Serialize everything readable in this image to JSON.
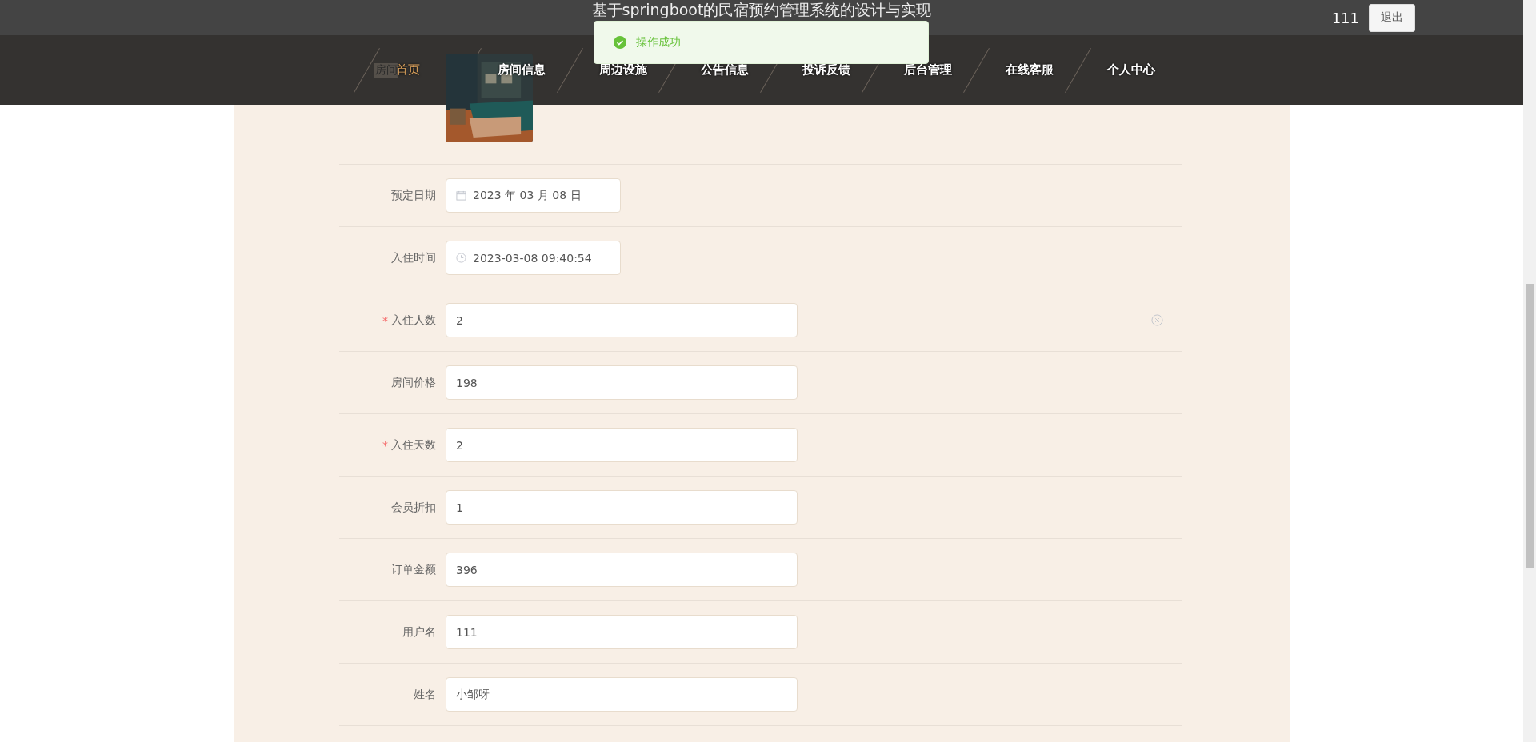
{
  "header": {
    "title": "基于springboot的民宿预约管理系统的设计与实现",
    "username": "111",
    "logout": "退出"
  },
  "toast": {
    "kind": "success",
    "message": "操作成功"
  },
  "nav": [
    {
      "label": "首页",
      "selected": true
    },
    {
      "label": "房间信息",
      "selected": false
    },
    {
      "label": "周边设施",
      "selected": false
    },
    {
      "label": "公告信息",
      "selected": false
    },
    {
      "label": "投诉反馈",
      "selected": false
    },
    {
      "label": "后台管理",
      "selected": false
    },
    {
      "label": "在线客服",
      "selected": false
    },
    {
      "label": "个人中心",
      "selected": false
    }
  ],
  "form": {
    "required_mark": "*",
    "picture_row": {
      "label": "房间",
      "kind": "picture"
    },
    "fields": [
      {
        "label": "预定日期",
        "kind": "date",
        "value": "2023 年 03 月 08 日",
        "required": false,
        "clearable": false
      },
      {
        "label": "入住时间",
        "kind": "time",
        "value": "2023-03-08 09:40:54",
        "required": false,
        "clearable": false
      },
      {
        "label": "入住人数",
        "kind": "text",
        "value": "2",
        "required": true,
        "clearable": true
      },
      {
        "label": "房间价格",
        "kind": "text",
        "value": "198",
        "required": false,
        "clearable": false
      },
      {
        "label": "入住天数",
        "kind": "text",
        "value": "2",
        "required": true,
        "clearable": false
      },
      {
        "label": "会员折扣",
        "kind": "text",
        "value": "1",
        "required": false,
        "clearable": false
      },
      {
        "label": "订单金额",
        "kind": "text",
        "value": "396",
        "required": false,
        "clearable": false
      },
      {
        "label": "用户名",
        "kind": "text",
        "value": "111",
        "required": false,
        "clearable": false
      },
      {
        "label": "姓名",
        "kind": "text",
        "value": "小邹呀",
        "required": false,
        "clearable": false
      }
    ]
  }
}
